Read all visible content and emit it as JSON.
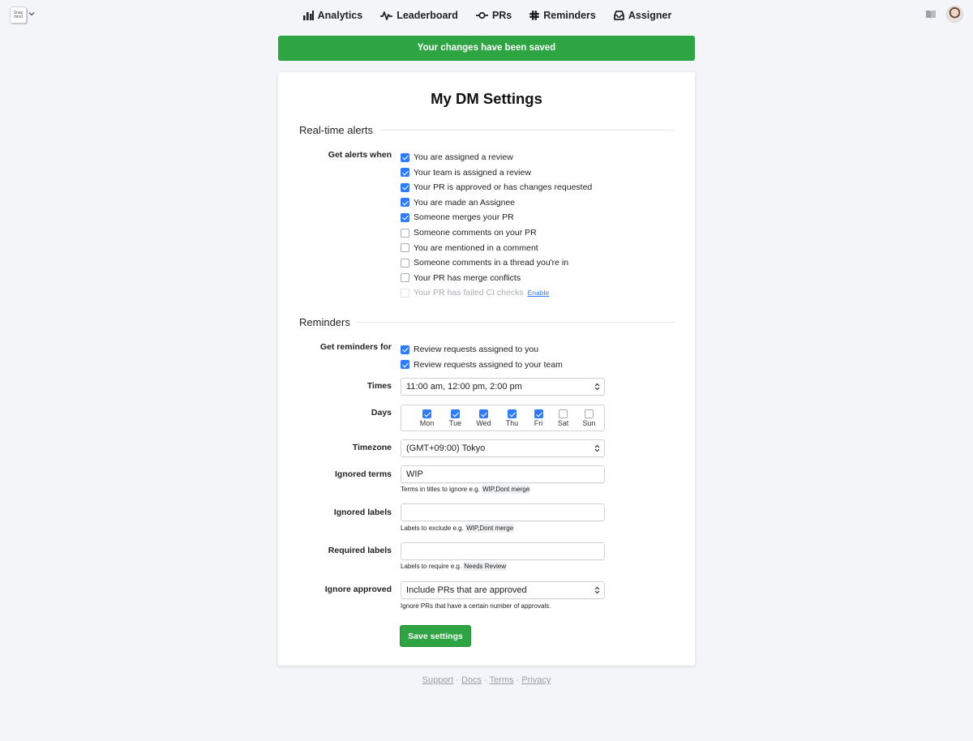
{
  "logo": {
    "text": "Snap mind"
  },
  "nav": [
    {
      "label": "Analytics",
      "icon": "bar-chart-icon"
    },
    {
      "label": "Leaderboard",
      "icon": "pulse-icon"
    },
    {
      "label": "PRs",
      "icon": "commit-icon"
    },
    {
      "label": "Reminders",
      "icon": "slack-icon"
    },
    {
      "label": "Assigner",
      "icon": "inbox-icon"
    }
  ],
  "banner": {
    "text": "Your changes have been saved",
    "color": "#2ea443"
  },
  "page": {
    "title": "My DM Settings"
  },
  "realtime": {
    "heading": "Real-time alerts",
    "label": "Get alerts when",
    "options": [
      {
        "text": "You are assigned a review",
        "checked": true
      },
      {
        "text": "Your team is assigned a review",
        "checked": true
      },
      {
        "text": "Your PR is approved or has changes requested",
        "checked": true
      },
      {
        "text": "You are made an Assignee",
        "checked": true
      },
      {
        "text": "Someone merges your PR",
        "checked": true
      },
      {
        "text": "Someone comments on your PR",
        "checked": false
      },
      {
        "text": "You are mentioned in a comment",
        "checked": false
      },
      {
        "text": "Someone comments in a thread you're in",
        "checked": false
      },
      {
        "text": "Your PR has merge conflicts",
        "checked": false
      },
      {
        "text": "Your PR has failed CI checks",
        "checked": false,
        "disabled": true
      }
    ],
    "enable_link": "Enable"
  },
  "reminders": {
    "heading": "Reminders",
    "label": "Get reminders for",
    "options": [
      {
        "text": "Review requests assigned to you",
        "checked": true
      },
      {
        "text": "Review requests assigned to your team",
        "checked": true
      }
    ],
    "times_label": "Times",
    "times_value": "11:00 am, 12:00 pm, 2:00 pm",
    "days_label": "Days",
    "days": [
      {
        "name": "Mon",
        "checked": true
      },
      {
        "name": "Tue",
        "checked": true
      },
      {
        "name": "Wed",
        "checked": true
      },
      {
        "name": "Thu",
        "checked": true
      },
      {
        "name": "Fri",
        "checked": true
      },
      {
        "name": "Sat",
        "checked": false
      },
      {
        "name": "Sun",
        "checked": false
      }
    ],
    "timezone_label": "Timezone",
    "timezone_value": "(GMT+09:00) Tokyo",
    "ignored_terms_label": "Ignored terms",
    "ignored_terms_value": "WIP",
    "ignored_terms_help": "Terms in titles to ignore e.g.",
    "ignored_terms_example": "WIP,Dont merge",
    "ignored_labels_label": "Ignored labels",
    "ignored_labels_value": "",
    "ignored_labels_help": "Labels to exclude e.g.",
    "ignored_labels_example": "WIP,Dont merge",
    "required_labels_label": "Required labels",
    "required_labels_value": "",
    "required_labels_help": "Labels to require e.g.",
    "required_labels_example": "Needs Review",
    "ignore_approved_label": "Ignore approved",
    "ignore_approved_value": "Include PRs that are approved",
    "ignore_approved_help": "Ignore PRs that have a certain number of approvals."
  },
  "save_button": "Save settings",
  "footer": {
    "links": [
      "Support",
      "Docs",
      "Terms",
      "Privacy"
    ],
    "separator": " · "
  }
}
